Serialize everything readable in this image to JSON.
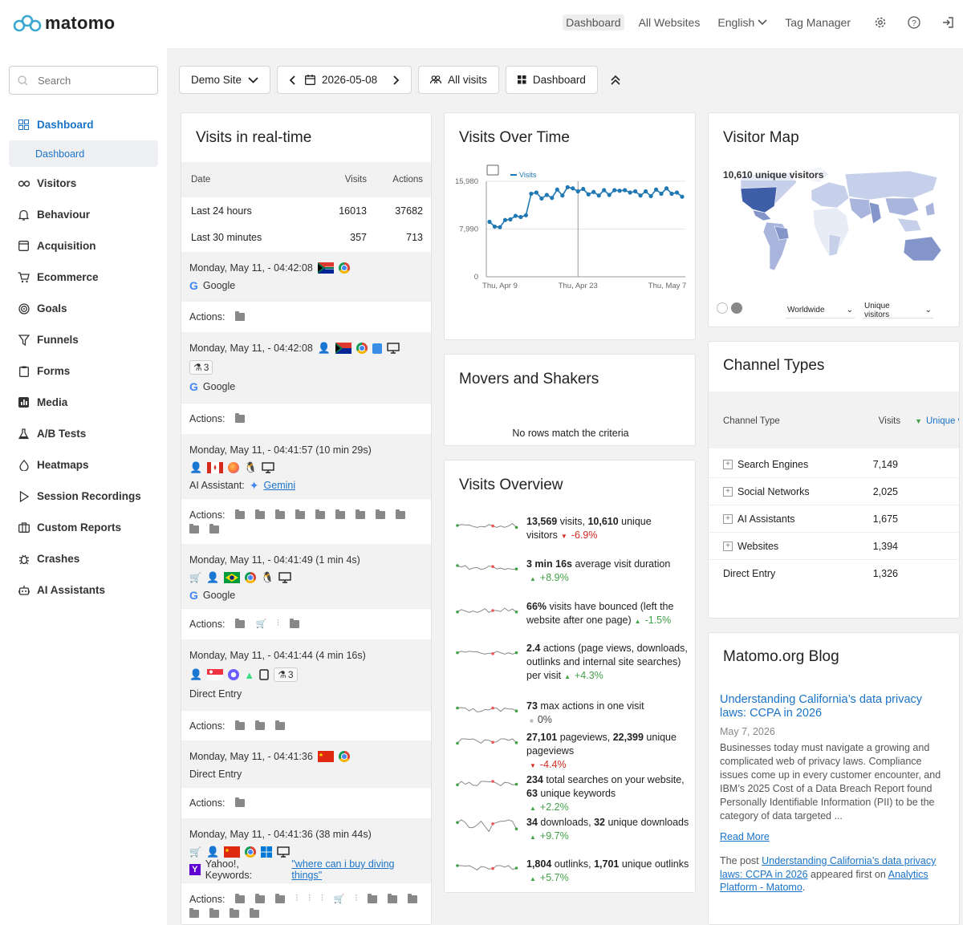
{
  "app": {
    "name": "matomo"
  },
  "topnav": {
    "dashboard": "Dashboard",
    "all_websites": "All Websites",
    "language": "English",
    "tag_manager": "Tag Manager"
  },
  "sidebar": {
    "search_placeholder": "Search",
    "items": [
      {
        "label": "Dashboard",
        "icon": "grid-icon"
      },
      {
        "label": "Visitors",
        "icon": "binoculars-icon"
      },
      {
        "label": "Behaviour",
        "icon": "bell-icon"
      },
      {
        "label": "Acquisition",
        "icon": "browser-icon"
      },
      {
        "label": "Ecommerce",
        "icon": "cart-icon"
      },
      {
        "label": "Goals",
        "icon": "target-icon"
      },
      {
        "label": "Funnels",
        "icon": "funnel-icon"
      },
      {
        "label": "Forms",
        "icon": "clipboard-icon"
      },
      {
        "label": "Media",
        "icon": "media-icon"
      },
      {
        "label": "A/B Tests",
        "icon": "flask-icon"
      },
      {
        "label": "Heatmaps",
        "icon": "drop-icon"
      },
      {
        "label": "Session Recordings",
        "icon": "play-icon"
      },
      {
        "label": "Custom Reports",
        "icon": "briefcase-icon"
      },
      {
        "label": "Crashes",
        "icon": "bug-icon"
      },
      {
        "label": "AI Assistants",
        "icon": "robot-icon"
      }
    ],
    "sub_dashboard": "Dashboard"
  },
  "toolbar": {
    "site": "Demo Site",
    "date": "2026-05-08",
    "segment": "All visits",
    "dashboard": "Dashboard"
  },
  "realtime": {
    "title": "Visits in real-time",
    "headers": [
      "Date",
      "Visits",
      "Actions"
    ],
    "rows": [
      {
        "label": "Last 24 hours",
        "visits": "16013",
        "actions": "37682"
      },
      {
        "label": "Last 30 minutes",
        "visits": "357",
        "actions": "713"
      }
    ],
    "actions_label": "Actions:",
    "visits": [
      {
        "time": "Monday, May 11, - 04:42:08",
        "source": "Google"
      },
      {
        "time": "Monday, May 11, - 04:42:08",
        "source": "Google",
        "badge": "3"
      },
      {
        "time": "Monday, May 11, - 04:41:57 (10 min 29s)",
        "source_prefix": "AI Assistant:",
        "source_link": "Gemini"
      },
      {
        "time": "Monday, May 11, - 04:41:49 (1 min 4s)",
        "source": "Google"
      },
      {
        "time": "Monday, May 11, - 04:41:44 (4 min 16s)",
        "source": "Direct Entry",
        "badge": "3"
      },
      {
        "time": "Monday, May 11, - 04:41:36",
        "source": "Direct Entry"
      },
      {
        "time": "Monday, May 11, - 04:41:36 (38 min 44s)",
        "source_prefix": "Yahoo!, Keywords:",
        "source_link": "\"where can i buy diving things\""
      }
    ]
  },
  "visits_over_time": {
    "title": "Visits Over Time",
    "legend": "Visits"
  },
  "chart_data": {
    "type": "line",
    "series": [
      {
        "name": "Visits",
        "values": [
          9200,
          8400,
          8300,
          9500,
          9600,
          10200,
          10000,
          10300,
          13900,
          14100,
          13100,
          13700,
          13200,
          14600,
          13600,
          15000,
          14800,
          14300,
          14700,
          13800,
          14200,
          13600,
          14500,
          13700,
          14500,
          14400,
          14500,
          14100,
          14300,
          13600,
          14300,
          13500,
          14600,
          13900,
          14800,
          13900,
          14100,
          13400
        ]
      }
    ],
    "xticks": [
      "Thu, Apr 9",
      "Thu, Apr 23",
      "Thu, May 7"
    ],
    "yticks": [
      "0",
      "7,990",
      "15,980"
    ],
    "ylim": [
      0,
      15980
    ],
    "grid": true
  },
  "movers": {
    "title": "Movers and Shakers",
    "empty": "No rows match the criteria"
  },
  "overview": {
    "title": "Visits Overview",
    "rows": [
      {
        "b1": "13,569",
        "t1": " visits, ",
        "b2": "10,610",
        "t2": " unique visitors",
        "change": "-6.9%",
        "trend": "neg"
      },
      {
        "b1": "3 min 16s",
        "t1": " average visit duration",
        "b2": "",
        "t2": "",
        "change": "+8.9%",
        "trend": "pos"
      },
      {
        "b1": "66%",
        "t1": " visits have bounced (left the website after one page)",
        "b2": "",
        "t2": "",
        "change": "-1.5%",
        "trend": "pos"
      },
      {
        "b1": "2.4",
        "t1": " actions (page views, downloads, outlinks and internal site searches) per visit",
        "b2": "",
        "t2": "",
        "change": "+4.3%",
        "trend": "pos"
      },
      {
        "b1": "73",
        "t1": " max actions in one visit",
        "b2": "",
        "t2": "",
        "change": "0%",
        "trend": "neu"
      },
      {
        "b1": "27,101",
        "t1": " pageviews, ",
        "b2": "22,399",
        "t2": " unique pageviews",
        "change": "-4.4%",
        "trend": "neg"
      },
      {
        "b1": "234",
        "t1": " total searches on your website, ",
        "b2": "63",
        "t2": " unique keywords",
        "change": "+2.2%",
        "trend": "pos"
      },
      {
        "b1": "34",
        "t1": " downloads, ",
        "b2": "32",
        "t2": " unique downloads",
        "change": "+9.7%",
        "trend": "pos"
      },
      {
        "b1": "1,804",
        "t1": " outlinks, ",
        "b2": "1,701",
        "t2": " unique outlinks",
        "change": "+5.7%",
        "trend": "pos"
      }
    ]
  },
  "visitor_map": {
    "title": "Visitor Map",
    "summary": "10,610 unique visitors",
    "region": "Worldwide",
    "metric": "Unique visitors"
  },
  "channels": {
    "title": "Channel Types",
    "headers": [
      "Channel Type",
      "Visits",
      "Unique v"
    ],
    "rows": [
      {
        "name": "Search Engines",
        "visits": "7,149"
      },
      {
        "name": "Social Networks",
        "visits": "2,025"
      },
      {
        "name": "AI Assistants",
        "visits": "1,675"
      },
      {
        "name": "Websites",
        "visits": "1,394"
      },
      {
        "name": "Direct Entry",
        "visits": "1,326"
      }
    ]
  },
  "blog": {
    "title": "Matomo.org Blog",
    "post_title": "Understanding California’s data privacy laws: CCPA in 2026",
    "date": "May 7, 2026",
    "summary": "Businesses today must navigate a growing and complicated web of privacy laws. Compliance issues come up in every customer encounter, and IBM’s 2025 Cost of a Data Breach Report found Personally Identifiable Information (PII) to be the category of data targeted ...",
    "read_more": "Read More",
    "post_prefix": "The post ",
    "post_link": "Understanding California’s data privacy laws: CCPA in 2026",
    "post_mid": " appeared first on ",
    "post_site": "Analytics Platform - Matomo",
    "post_end": "."
  }
}
